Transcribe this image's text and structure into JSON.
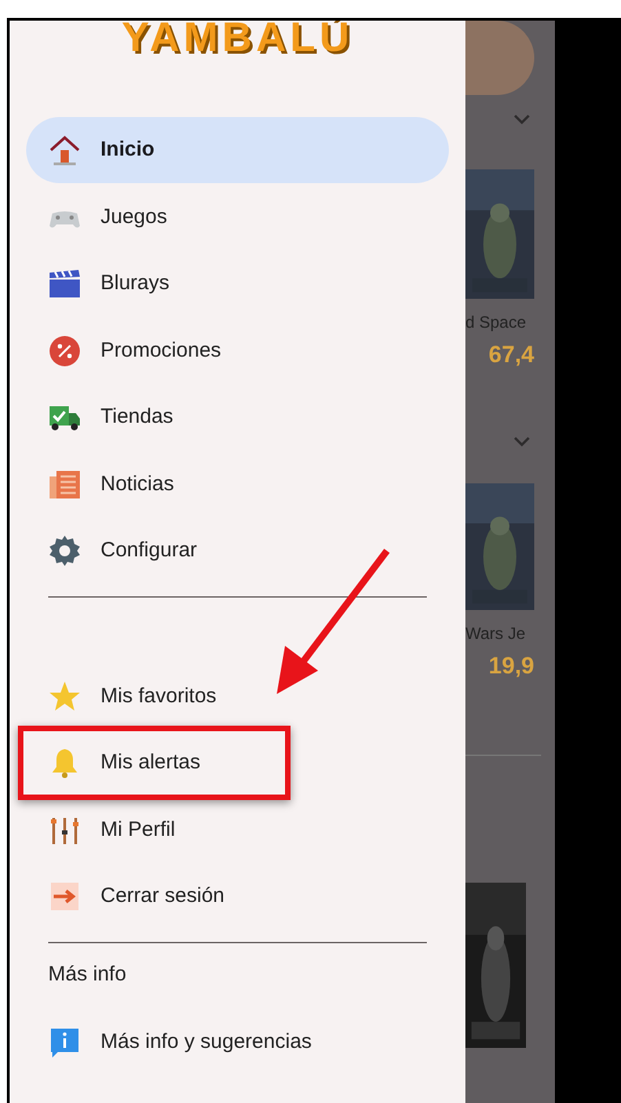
{
  "drawer": {
    "logo": "YAMBALÚ",
    "items": [
      {
        "label": "Inicio",
        "selected": true,
        "highlighted": false
      },
      {
        "label": "Juegos",
        "selected": false,
        "highlighted": false
      },
      {
        "label": "Blurays",
        "selected": false,
        "highlighted": false
      },
      {
        "label": "Promociones",
        "selected": false,
        "highlighted": false
      },
      {
        "label": "Tiendas",
        "selected": false,
        "highlighted": false
      },
      {
        "label": "Noticias",
        "selected": false,
        "highlighted": false
      },
      {
        "label": "Configurar",
        "selected": false,
        "highlighted": false
      }
    ],
    "account_items": [
      {
        "label": "Mis favoritos",
        "selected": false,
        "highlighted": false
      },
      {
        "label": "Mis alertas",
        "selected": false,
        "highlighted": true
      },
      {
        "label": "Mi Perfil",
        "selected": false,
        "highlighted": false
      },
      {
        "label": "Cerrar sesión",
        "selected": false,
        "highlighted": false
      }
    ],
    "section_title": "Más info",
    "info_items": [
      {
        "label": "Más info y sugerencias",
        "selected": false,
        "highlighted": false
      }
    ]
  },
  "background": {
    "products": [
      {
        "title": "d Space",
        "price": "67,4"
      },
      {
        "title": "Wars Je",
        "price": "19,9"
      }
    ]
  }
}
